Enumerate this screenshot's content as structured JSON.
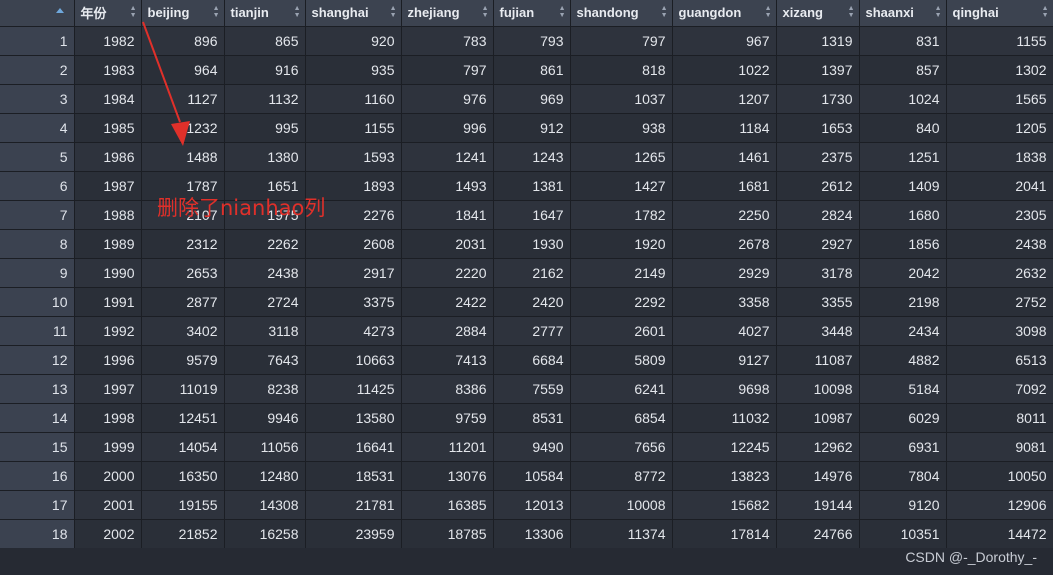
{
  "table": {
    "columns": [
      "",
      "年份",
      "beijing",
      "tianjin",
      "shanghai",
      "zhejiang",
      "fujian",
      "shandong",
      "guangdon",
      "xizang",
      "shaanxi",
      "qinghai"
    ],
    "rows": [
      [
        "1",
        "1982",
        "896",
        "865",
        "920",
        "783",
        "793",
        "797",
        "967",
        "1319",
        "831",
        "1155"
      ],
      [
        "2",
        "1983",
        "964",
        "916",
        "935",
        "797",
        "861",
        "818",
        "1022",
        "1397",
        "857",
        "1302"
      ],
      [
        "3",
        "1984",
        "1127",
        "1132",
        "1160",
        "976",
        "969",
        "1037",
        "1207",
        "1730",
        "1024",
        "1565"
      ],
      [
        "4",
        "1985",
        "1232",
        "995",
        "1155",
        "996",
        "912",
        "938",
        "1184",
        "1653",
        "840",
        "1205"
      ],
      [
        "5",
        "1986",
        "1488",
        "1380",
        "1593",
        "1241",
        "1243",
        "1265",
        "1461",
        "2375",
        "1251",
        "1838"
      ],
      [
        "6",
        "1987",
        "1787",
        "1651",
        "1893",
        "1493",
        "1381",
        "1427",
        "1681",
        "2612",
        "1409",
        "2041"
      ],
      [
        "7",
        "1988",
        "2107",
        "1975",
        "2276",
        "1841",
        "1647",
        "1782",
        "2250",
        "2824",
        "1680",
        "2305"
      ],
      [
        "8",
        "1989",
        "2312",
        "2262",
        "2608",
        "2031",
        "1930",
        "1920",
        "2678",
        "2927",
        "1856",
        "2438"
      ],
      [
        "9",
        "1990",
        "2653",
        "2438",
        "2917",
        "2220",
        "2162",
        "2149",
        "2929",
        "3178",
        "2042",
        "2632"
      ],
      [
        "10",
        "1991",
        "2877",
        "2724",
        "3375",
        "2422",
        "2420",
        "2292",
        "3358",
        "3355",
        "2198",
        "2752"
      ],
      [
        "11",
        "1992",
        "3402",
        "3118",
        "4273",
        "2884",
        "2777",
        "2601",
        "4027",
        "3448",
        "2434",
        "3098"
      ],
      [
        "12",
        "1996",
        "9579",
        "7643",
        "10663",
        "7413",
        "6684",
        "5809",
        "9127",
        "11087",
        "4882",
        "6513"
      ],
      [
        "13",
        "1997",
        "11019",
        "8238",
        "11425",
        "8386",
        "7559",
        "6241",
        "9698",
        "10098",
        "5184",
        "7092"
      ],
      [
        "14",
        "1998",
        "12451",
        "9946",
        "13580",
        "9759",
        "8531",
        "6854",
        "11032",
        "10987",
        "6029",
        "8011"
      ],
      [
        "15",
        "1999",
        "14054",
        "11056",
        "16641",
        "11201",
        "9490",
        "7656",
        "12245",
        "12962",
        "6931",
        "9081"
      ],
      [
        "16",
        "2000",
        "16350",
        "12480",
        "18531",
        "13076",
        "10584",
        "8772",
        "13823",
        "14976",
        "7804",
        "10050"
      ],
      [
        "17",
        "2001",
        "19155",
        "14308",
        "21781",
        "16385",
        "12013",
        "10008",
        "15682",
        "19144",
        "9120",
        "12906"
      ],
      [
        "18",
        "2002",
        "21852",
        "16258",
        "23959",
        "18785",
        "13306",
        "11374",
        "17814",
        "24766",
        "10351",
        "14472"
      ]
    ]
  },
  "annotation": {
    "text": "删除了nianhao列",
    "color": "#e0302a"
  },
  "watermark": "CSDN @-_Dorothy_-",
  "colors": {
    "header_bg": "#3c4350",
    "row_bg": "#2e333d",
    "rownum_bg": "#3b4250",
    "page_bg": "#262a33"
  }
}
